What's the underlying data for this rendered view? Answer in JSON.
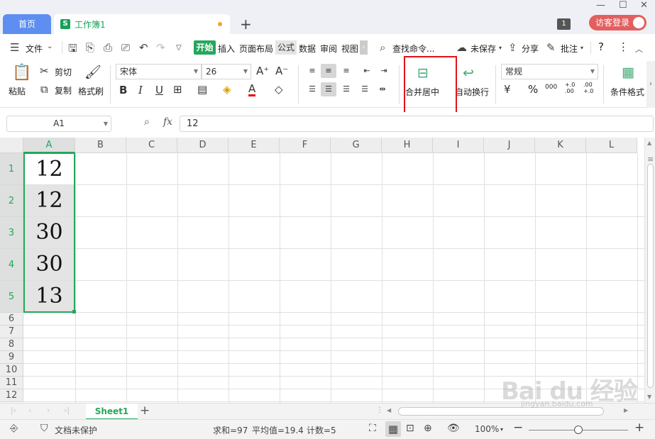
{
  "tabs": {
    "home": "首页",
    "doc_title": "工作簿1",
    "doc_icon": "S",
    "add": "+"
  },
  "window": {
    "badge": "1",
    "login": "访客登录"
  },
  "menu": {
    "file": "文件",
    "tabs": [
      "开始",
      "插入",
      "页面布局",
      "公式",
      "数据",
      "审阅",
      "视图"
    ],
    "search": "查找命令...",
    "unsaved": "未保存",
    "share": "分享",
    "comment": "批注",
    "help": "?",
    "more": "⋮"
  },
  "ribbon": {
    "paste": "粘贴",
    "cut": "剪切",
    "copy": "复制",
    "format_painter": "格式刷",
    "font_name": "宋体",
    "font_size": "26",
    "merge_center": "合并居中",
    "wrap_text": "自动换行",
    "number_format": "常规",
    "conditional_format": "条件格式",
    "percent": "%",
    "thousand": "000",
    "inc_decimal": "+.0 .00",
    "dec_decimal": ".00 +.0"
  },
  "formula": {
    "name_box": "A1",
    "fx": "fx",
    "value": "12"
  },
  "grid": {
    "columns": [
      "A",
      "B",
      "C",
      "D",
      "E",
      "F",
      "G",
      "H",
      "I",
      "J",
      "K",
      "L"
    ],
    "rows": [
      "1",
      "2",
      "3",
      "4",
      "5",
      "6",
      "7",
      "8",
      "9",
      "10",
      "11",
      "12"
    ],
    "cells": [
      "12",
      "12",
      "30",
      "30",
      "13"
    ]
  },
  "sheets": {
    "active": "Sheet1",
    "add": "+"
  },
  "status": {
    "protect": "文档未保护",
    "sum": "求和=97",
    "avg": "平均值=19.4",
    "count": "计数=5",
    "zoom": "100%"
  },
  "watermark": {
    "main": "Bai du 经验",
    "sub": "jingyan.baidu.com"
  },
  "colors": {
    "accent": "#26a65b",
    "tab_blue": "#5d8ef0",
    "login_red": "#e35f5f",
    "highlight_box": "#e0131a"
  }
}
